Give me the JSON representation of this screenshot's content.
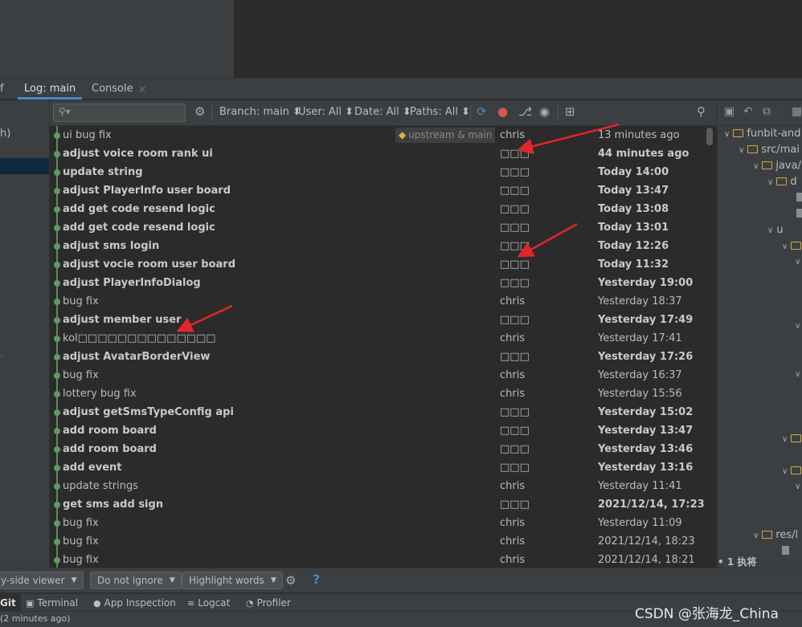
{
  "tabs": {
    "partial_left": "f",
    "log": "Log: main",
    "console": "Console",
    "close_glyph": "×"
  },
  "left_strip": {
    "partial_h": "h)",
    "partial_dot": "·"
  },
  "toolbar": {
    "search_placeholder": "",
    "search_icon": "search-icon",
    "filters": {
      "branch": "Branch: main ⬍",
      "user": "User: All ⬍",
      "date": "Date: All ⬍",
      "paths": "Paths: All ⬍"
    },
    "icons": [
      "settings-icon",
      "refresh-icon",
      "cherry-pick-icon",
      "branch-graph-icon",
      "eye-icon",
      "new-tab-icon",
      "zoom-icon"
    ]
  },
  "accent_color": "#4a88c7",
  "commits": [
    {
      "message": "ui bug fix",
      "author": "chris",
      "date": "13 minutes ago",
      "bold": false,
      "tag": "upstream & main"
    },
    {
      "message": "adjust voice room rank ui",
      "author": "□□□",
      "date": "44 minutes ago",
      "bold": true
    },
    {
      "message": "update string",
      "author": "□□□",
      "date": "Today 14:00",
      "bold": true
    },
    {
      "message": "adjust PlayerInfo user board",
      "author": "□□□",
      "date": "Today 13:47",
      "bold": true
    },
    {
      "message": "add get code resend logic",
      "author": "□□□",
      "date": "Today 13:08",
      "bold": true
    },
    {
      "message": "add get code resend logic",
      "author": "□□□",
      "date": "Today 13:01",
      "bold": true
    },
    {
      "message": "adjust sms login",
      "author": "□□□",
      "date": "Today 12:26",
      "bold": true
    },
    {
      "message": "adjust vocie room user board",
      "author": "□□□",
      "date": "Today 11:32",
      "bold": true
    },
    {
      "message": "adjust PlayerInfoDialog",
      "author": "□□□",
      "date": "Yesterday 19:00",
      "bold": true
    },
    {
      "message": "bug fix",
      "author": "chris",
      "date": "Yesterday 18:37",
      "bold": false
    },
    {
      "message": "adjust member user",
      "author": "□□□",
      "date": "Yesterday 17:49",
      "bold": true
    },
    {
      "message": "kol□□□□□□□□□□□□□□",
      "author": "chris",
      "date": "Yesterday 17:41",
      "bold": false
    },
    {
      "message": "adjust AvatarBorderView",
      "author": "□□□",
      "date": "Yesterday 17:26",
      "bold": true
    },
    {
      "message": "bug fix",
      "author": "chris",
      "date": "Yesterday 16:37",
      "bold": false
    },
    {
      "message": "lottery bug fix",
      "author": "chris",
      "date": "Yesterday 15:56",
      "bold": false
    },
    {
      "message": "adjust getSmsTypeConfig api",
      "author": "□□□",
      "date": "Yesterday 15:02",
      "bold": true
    },
    {
      "message": "add room board",
      "author": "□□□",
      "date": "Yesterday 13:47",
      "bold": true
    },
    {
      "message": "add room board",
      "author": "□□□",
      "date": "Yesterday 13:46",
      "bold": true
    },
    {
      "message": "add event",
      "author": "□□□",
      "date": "Yesterday 13:16",
      "bold": true
    },
    {
      "message": "update strings",
      "author": "chris",
      "date": "Yesterday 11:41",
      "bold": false
    },
    {
      "message": "get sms add sign",
      "author": "□□□",
      "date": "2021/12/14, 17:23",
      "bold": true
    },
    {
      "message": "bug fix",
      "author": "chris",
      "date": "Yesterday 11:09",
      "bold": false
    },
    {
      "message": "bug fix",
      "author": "chris",
      "date": "2021/12/14, 18:23",
      "bold": false
    },
    {
      "message": "bug fix",
      "author": "chris",
      "date": "2021/12/14, 18:21",
      "bold": false
    }
  ],
  "tree": {
    "items": [
      {
        "label": "funbit-and"
      },
      {
        "label": "src/mai"
      },
      {
        "label": "java/"
      },
      {
        "label": "d"
      },
      {
        "label": "u"
      },
      {
        "label": "res/l"
      }
    ],
    "bottom_label": "• 1 执将"
  },
  "bottom_toolbar": {
    "viewer": "y-side viewer",
    "ignore": "Do not ignore",
    "highlight": "Highlight words",
    "help": "?"
  },
  "toolwindows": {
    "git": "Git",
    "terminal": "Terminal",
    "app_inspection": "App Inspection",
    "logcat": "Logcat",
    "profiler": "Profiler"
  },
  "status": "(2 minutes ago)",
  "watermark": "CSDN @张海龙_China"
}
